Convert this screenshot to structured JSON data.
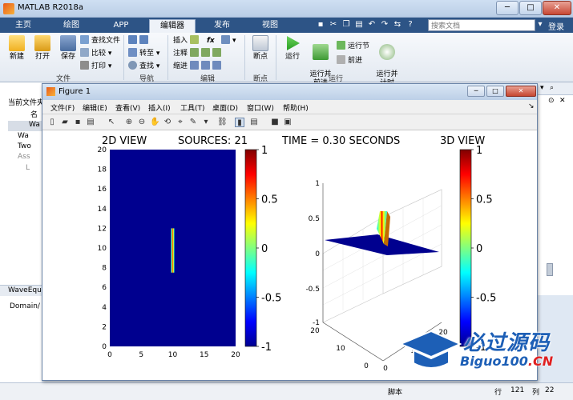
{
  "window": {
    "title": "MATLAB R2018a"
  },
  "tabs": [
    {
      "label": "主页"
    },
    {
      "label": "绘图"
    },
    {
      "label": "APP"
    },
    {
      "label": "编辑器"
    },
    {
      "label": "发布"
    },
    {
      "label": "视图"
    }
  ],
  "search": {
    "placeholder": "搜索文档"
  },
  "login_label": "登录",
  "ribbon": {
    "file": {
      "new": "新建",
      "open": "打开",
      "save": "保存",
      "find_files": "查找文件",
      "compare": "比较",
      "print": "打印",
      "section": "文件"
    },
    "nav": {
      "goto": "转至",
      "find": "查找",
      "section": "导航"
    },
    "edit": {
      "insert": "插入",
      "fx": "fx",
      "comment": "注释",
      "indent": "缩进",
      "section": "编辑"
    },
    "breakpoints": {
      "label": "断点",
      "section": "断点"
    },
    "run": {
      "run": "运行",
      "run_advance": "运行并\n前进",
      "run_section": "运行节",
      "advance": "前进",
      "run_time": "运行并\n计时",
      "section": "运行"
    }
  },
  "left_panel": {
    "current_folder": "当前文件夹",
    "name_header": "名",
    "items": [
      "Wa",
      "Wa",
      "Two",
      "Ass",
      "L"
    ],
    "workspace_label": "WaveEqu",
    "domain_label": "Domain/"
  },
  "status_bar": {
    "script": "脚本",
    "row_label": "行",
    "row": "121",
    "col_label": "列",
    "col": "22"
  },
  "figure": {
    "title": "Figure 1",
    "menu": [
      "文件(F)",
      "编辑(E)",
      "查看(V)",
      "插入(I)",
      "工具(T)",
      "桌面(D)",
      "窗口(W)",
      "帮助(H)"
    ]
  },
  "plot_text": {
    "title_2d": "2D VIEW",
    "sources": "SOURCES: 21",
    "time": "TIME = 0.30 SECONDS",
    "title_3d": "3D VIEW"
  },
  "chart_data": [
    {
      "type": "heatmap",
      "title": "2D VIEW",
      "xlim": [
        0,
        20
      ],
      "ylim": [
        0,
        20
      ],
      "x_ticks": [
        0,
        5,
        10,
        15,
        20
      ],
      "y_ticks": [
        0,
        2,
        4,
        6,
        8,
        10,
        12,
        14,
        16,
        18,
        20
      ],
      "source_line": {
        "x": 10,
        "y_from": 7.5,
        "y_to": 12
      },
      "colorbar": {
        "range": [
          -1,
          1
        ],
        "ticks": [
          1,
          0.5,
          0,
          -0.5,
          -1
        ],
        "tick_labels": [
          "1",
          "0.5",
          "0",
          "-0.5",
          "-1"
        ]
      },
      "colors": {
        "background": "#00008f",
        "peak": "#a00000"
      }
    },
    {
      "type": "surface",
      "title": "3D VIEW",
      "z_ticks": [
        "1",
        "0.5",
        "0",
        "-0.5",
        "-1"
      ],
      "x_ticks": [
        "0",
        "10",
        "20"
      ],
      "y_ticks": [
        "20",
        "10",
        "0"
      ],
      "colorbar": {
        "range": [
          -1,
          1
        ],
        "ticks": [
          1,
          0.5,
          0,
          -0.5,
          -1
        ],
        "tick_labels": [
          "1",
          "0.5",
          "0",
          "-0.5",
          "-1"
        ]
      }
    }
  ],
  "watermark": {
    "cn": "必过源码",
    "en_main": "Biguo100",
    "en_suffix": ".CN"
  }
}
